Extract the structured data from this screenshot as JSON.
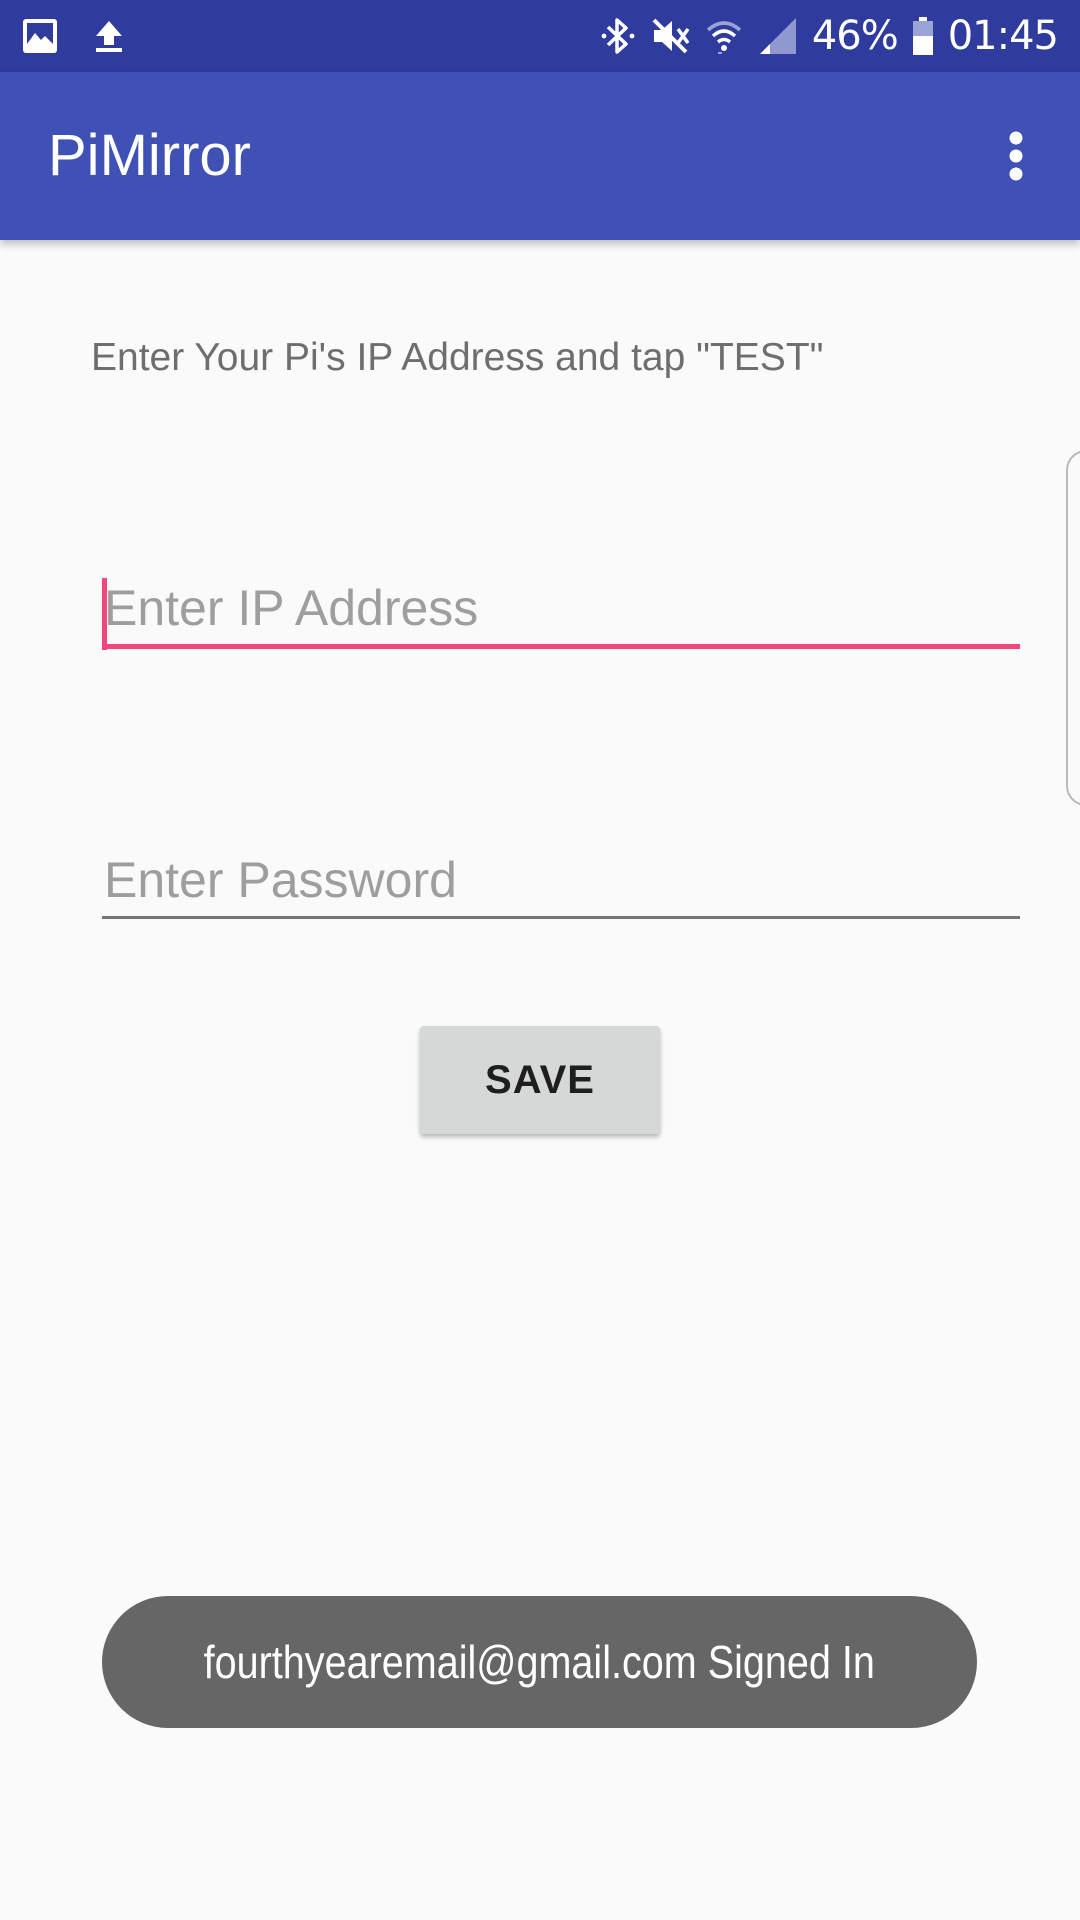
{
  "status_bar": {
    "left_icons": [
      "image-icon",
      "upload-icon"
    ],
    "right_icons": [
      "bluetooth-icon",
      "mute-icon",
      "wifi-icon",
      "signal-icon",
      "battery-icon"
    ],
    "battery_percent": "46%",
    "time": "01:45"
  },
  "app_bar": {
    "title": "PiMirror",
    "menu_icon": "more-vert-icon"
  },
  "form": {
    "instruction": "Enter Your Pi's IP Address and tap \"TEST\"",
    "ip_placeholder": "Enter IP Address",
    "ip_value": "",
    "password_placeholder": "Enter Password",
    "password_value": "",
    "save_label": "SAVE"
  },
  "toast": {
    "message": "fourthyearemail@gmail.com Signed In"
  },
  "colors": {
    "status_bar": "#2f3c9e",
    "app_bar": "#3f51b5",
    "accent": "#f0487c",
    "background": "#fafafa",
    "button": "#d6d7d7",
    "toast": "#666666"
  }
}
